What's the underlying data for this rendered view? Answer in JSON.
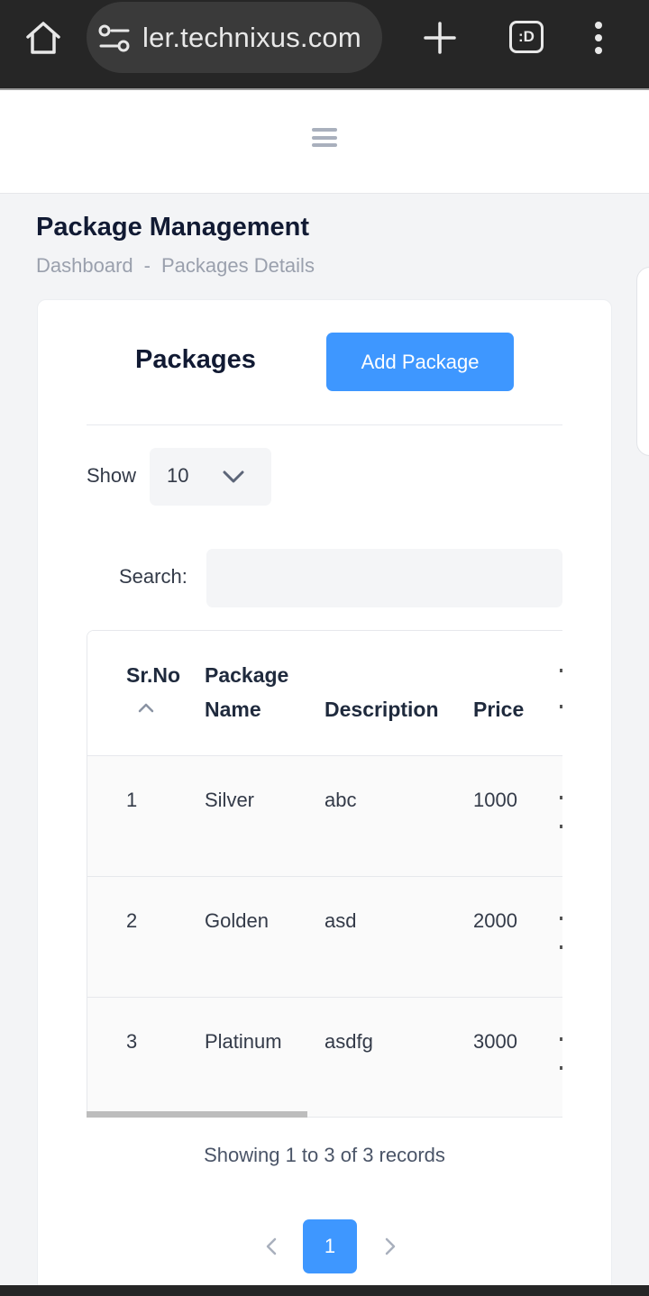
{
  "browser": {
    "url": "ler.technixus.com",
    "tabs_label": ":D"
  },
  "page": {
    "title": "Package Management",
    "breadcrumb": [
      "Dashboard",
      "Packages Details"
    ],
    "breadcrumb_separator": "-"
  },
  "card": {
    "title": "Packages",
    "add_button": "Add Package"
  },
  "controls": {
    "show_label": "Show",
    "show_value": "10",
    "search_label": "Search:",
    "search_value": ""
  },
  "table": {
    "columns": [
      {
        "line1": "Sr.No",
        "line2": ""
      },
      {
        "line1": "Package",
        "line2": "Name"
      },
      {
        "line1": "",
        "line2": "Description"
      },
      {
        "line1": "",
        "line2": "Price"
      }
    ],
    "rows": [
      {
        "sr": "1",
        "name": "Silver",
        "description": "abc",
        "price": "1000"
      },
      {
        "sr": "2",
        "name": "Golden",
        "description": "asd",
        "price": "2000"
      },
      {
        "sr": "3",
        "name": "Platinum",
        "description": "asdfg",
        "price": "3000"
      }
    ]
  },
  "footer": {
    "records_text": "Showing 1 to 3 of 3 records",
    "current_page": "1"
  },
  "colors": {
    "accent": "#3e97ff",
    "heading": "#111a33",
    "browser_bar": "#262626"
  },
  "icons": {
    "home": "home-icon",
    "site_settings": "tune-icon",
    "new_tab": "plus-icon",
    "menu": "more-vert-icon",
    "nav": "hamburger-icon",
    "select": "chevron-down-icon",
    "sort": "sort-asc-icon",
    "prev": "chevron-left-icon",
    "next": "chevron-right-icon"
  }
}
